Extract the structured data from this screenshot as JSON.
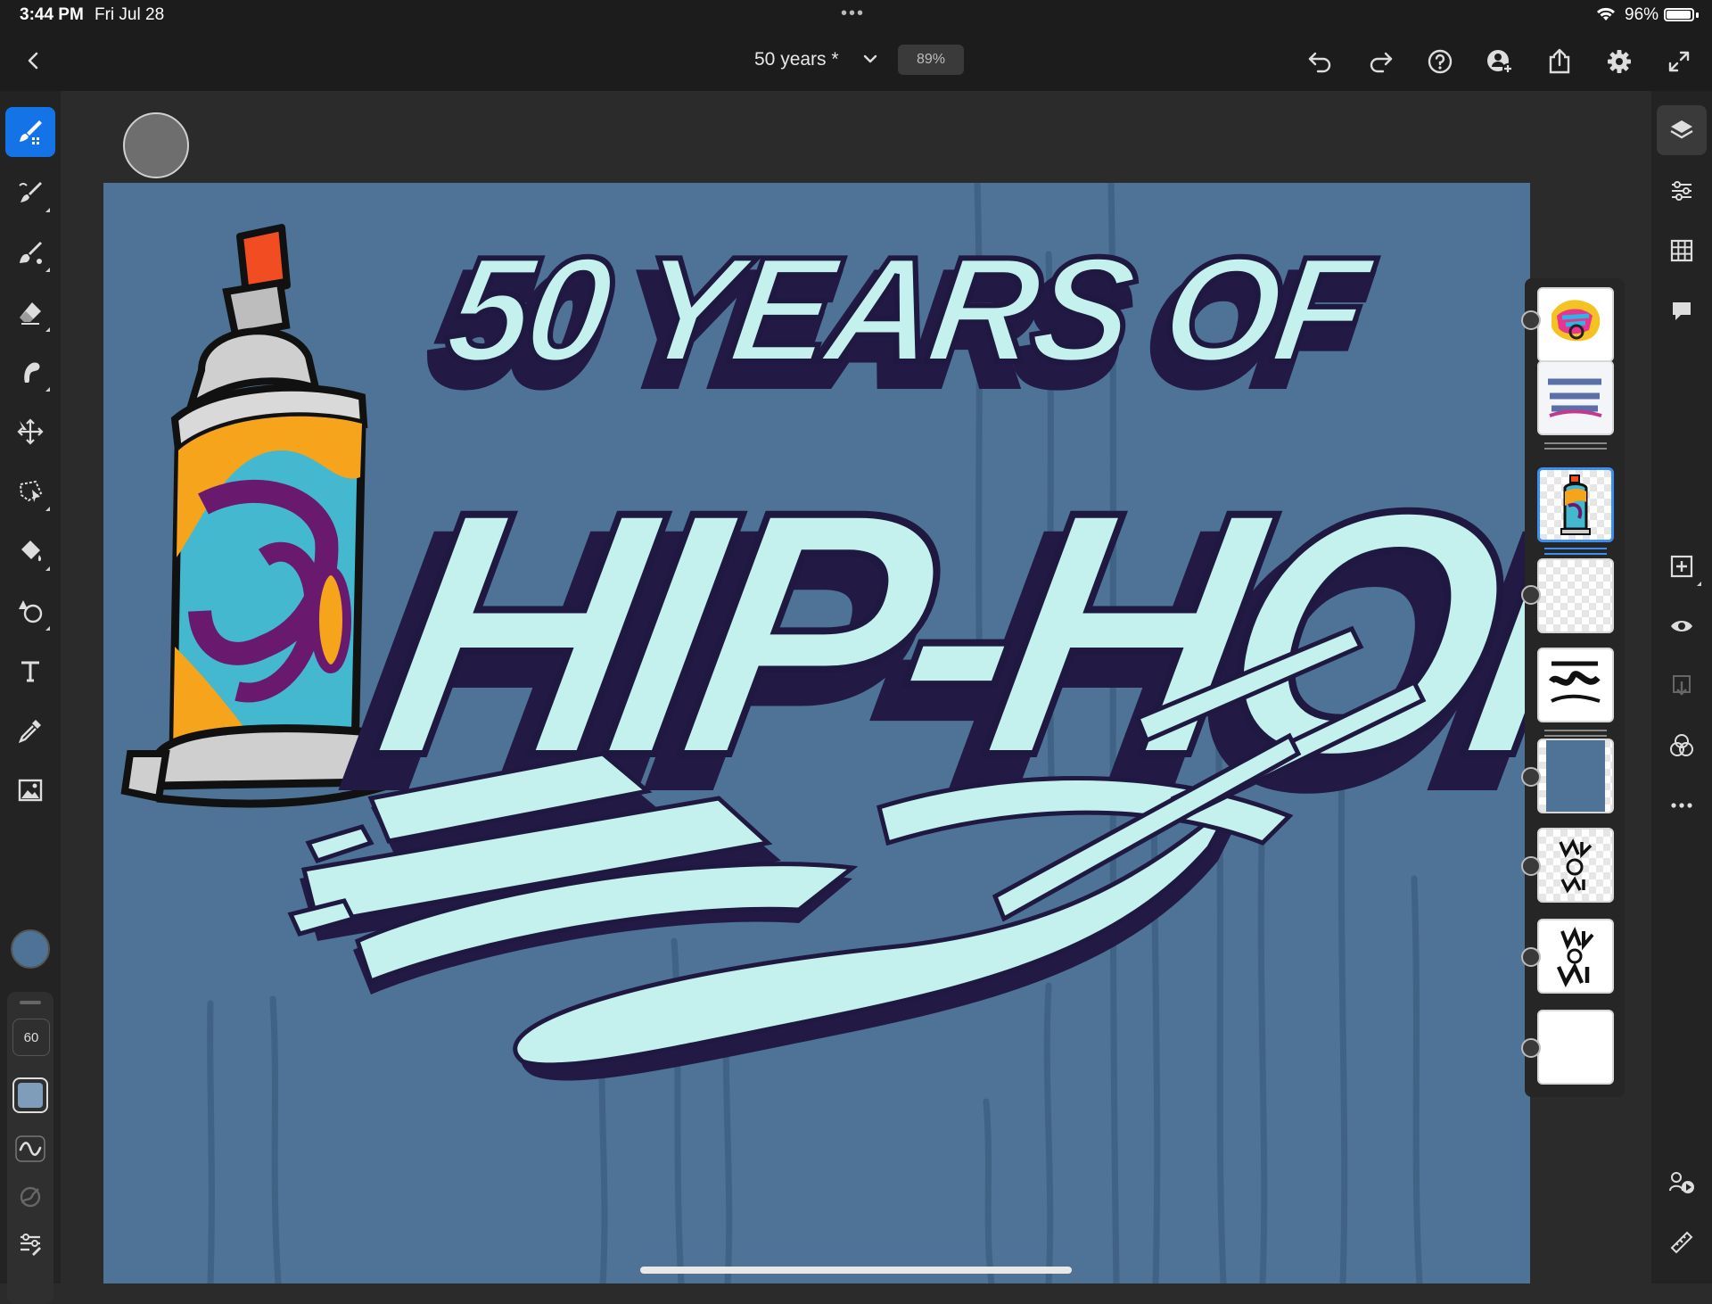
{
  "status_bar": {
    "time": "3:44 PM",
    "date": "Fri Jul 28",
    "battery": "96%",
    "battery_level": 0.96
  },
  "toolbar": {
    "back_icon": "chevron-left-icon",
    "document_title": "50 years *",
    "zoom": "89%",
    "actions": [
      "undo-icon",
      "redo-icon",
      "help-icon",
      "invite-icon",
      "share-icon",
      "settings-icon",
      "fullscreen-icon"
    ]
  },
  "left_tools": [
    "pixel-brush-icon",
    "live-brush-icon",
    "vector-brush-icon",
    "eraser-icon",
    "smudge-icon",
    "move-icon",
    "selection-icon",
    "fill-icon",
    "shapes-icon",
    "text-icon",
    "eyedropper-icon",
    "image-icon"
  ],
  "brush_settings": {
    "size": "60",
    "swatch_color": "#7f9cba",
    "icons": [
      "handle",
      "flow-icon",
      "pressure-icon",
      "brush-settings-icon"
    ]
  },
  "colors": {
    "accent": "#1473e6",
    "current_color": "#4e7396",
    "canvas_background": "#4e7396",
    "letter_fill": "#c4f1ee",
    "letter_outline": "#1f1840"
  },
  "right_tools": [
    "layers-icon",
    "properties-icon",
    "grid-icon",
    "comments-icon",
    "add-layer-icon",
    "visibility-icon",
    "merge-down-icon",
    "blend-icon",
    "more-icon",
    "livestream-icon",
    "ruler-icon"
  ],
  "canvas_art": {
    "headline_top": "50 YEARS OF",
    "headline_main": "HIP-HOP"
  },
  "layers": [
    {
      "label": "",
      "selected": false
    },
    {
      "label": "",
      "selected": false
    },
    {
      "label": "",
      "selected": true
    },
    {
      "label": "",
      "selected": false
    },
    {
      "label": "",
      "selected": false
    },
    {
      "label": "",
      "selected": false
    },
    {
      "label": "",
      "selected": false
    },
    {
      "label": "",
      "selected": false
    },
    {
      "label": "",
      "selected": false
    }
  ]
}
